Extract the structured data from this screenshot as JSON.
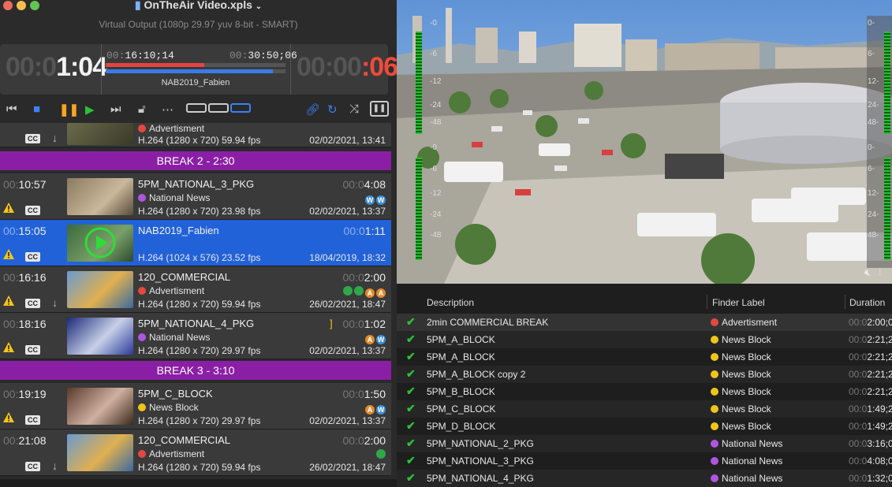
{
  "window": {
    "title": "OnTheAir Video.xpls",
    "subtitle": "Virtual Output (1080p 29.97 yuv 8-bit - SMART)"
  },
  "timer": {
    "elapsed_dim": "00:0",
    "elapsed": "1:04",
    "clip_start": "00:16:10;14",
    "clip_end": "00:30:50;06",
    "now_playing": "NAB2019_Fabien",
    "remaining_dim": "00:00",
    "remaining": ":06",
    "progress_red": 0.55,
    "progress_blue": 0.93
  },
  "playlist": {
    "top_row": {
      "label": "Advertisment",
      "codec": "H.264 (1280 x 720) 59.94 fps",
      "date": "02/02/2021, 13:41",
      "cc": "CC"
    },
    "break2": "BREAK 2 - 2:30",
    "break3": "BREAK 3 - 3:10",
    "rows": [
      {
        "start_dim": "00:",
        "start": "10:57",
        "name": "5PM_NATIONAL_3_PKG",
        "label": "National News",
        "codec": "H.264 (1280 x 720) 23.98 fps",
        "dur_dim": "00:0",
        "dur": "4:08",
        "date": "02/02/2021, 13:37",
        "cc": "CC"
      },
      {
        "start_dim": "00:",
        "start": "15:05",
        "name": "NAB2019_Fabien",
        "label": "",
        "codec": "H.264 (1024 x 576) 23.52 fps",
        "dur_dim": "00:0",
        "dur": "1:11",
        "date": "18/04/2019, 18:32",
        "cc": "CC"
      },
      {
        "start_dim": "00:",
        "start": "16:16",
        "name": "120_COMMERCIAL",
        "label": "Advertisment",
        "codec": "H.264 (1280 x 720) 59.94 fps",
        "dur_dim": "00:0",
        "dur": "2:00",
        "date": "26/02/2021, 18:47",
        "cc": "CC"
      },
      {
        "start_dim": "00:",
        "start": "18:16",
        "name": "5PM_NATIONAL_4_PKG",
        "label": "National News",
        "codec": "H.264 (1280 x 720) 29.97 fps",
        "dur_dim": "00:0",
        "dur": "1:02",
        "date": "02/02/2021, 13:37",
        "cc": "CC"
      },
      {
        "start_dim": "00:",
        "start": "19:19",
        "name": "5PM_C_BLOCK",
        "label": "News Block",
        "codec": "H.264 (1280 x 720) 29.97 fps",
        "dur_dim": "00:0",
        "dur": "1:50",
        "date": "02/02/2021, 13:37",
        "cc": "CC"
      },
      {
        "start_dim": "00:",
        "start": "21:08",
        "name": "120_COMMERCIAL",
        "label": "Advertisment",
        "codec": "H.264 (1280 x 720) 59.94 fps",
        "dur_dim": "00:0",
        "dur": "2:00",
        "date": "26/02/2021, 18:47",
        "cc": "CC"
      }
    ]
  },
  "meters": {
    "left": [
      "-0",
      "-6",
      "-12",
      "-24",
      "-48",
      "-0",
      "-6",
      "-12",
      "-24",
      "-48"
    ],
    "right": [
      "0-",
      "6-",
      "12-",
      "24-",
      "48-",
      "0-",
      "6-",
      "12-",
      "24-",
      "48-"
    ]
  },
  "table": {
    "headers": {
      "description": "Description",
      "finder_label": "Finder Label",
      "duration": "Duration"
    },
    "rows": [
      {
        "desc": "2min COMMERCIAL BREAK",
        "label": "Advertisment",
        "color": "#e5483f",
        "dur_dim": "00:0",
        "dur": "2:00;0"
      },
      {
        "desc": "5PM_A_BLOCK",
        "label": "News Block",
        "color": "#f0c419",
        "dur_dim": "00:0",
        "dur": "2:21;2"
      },
      {
        "desc": "5PM_A_BLOCK",
        "label": "News Block",
        "color": "#f0c419",
        "dur_dim": "00:0",
        "dur": "2:21;2"
      },
      {
        "desc": "5PM_A_BLOCK copy 2",
        "label": "News Block",
        "color": "#f0c419",
        "dur_dim": "00:0",
        "dur": "2:21;2"
      },
      {
        "desc": "5PM_B_BLOCK",
        "label": "News Block",
        "color": "#f0c419",
        "dur_dim": "00:0",
        "dur": "2:21;2"
      },
      {
        "desc": "5PM_C_BLOCK",
        "label": "News Block",
        "color": "#f0c419",
        "dur_dim": "00:0",
        "dur": "1:49;2"
      },
      {
        "desc": "5PM_D_BLOCK",
        "label": "News Block",
        "color": "#f0c419",
        "dur_dim": "00:0",
        "dur": "1:49;2"
      },
      {
        "desc": "5PM_NATIONAL_2_PKG",
        "label": "National News",
        "color": "#b055e0",
        "dur_dim": "00:0",
        "dur": "3:16;0"
      },
      {
        "desc": "5PM_NATIONAL_3_PKG",
        "label": "National News",
        "color": "#b055e0",
        "dur_dim": "00:0",
        "dur": "4:08;0"
      },
      {
        "desc": "5PM_NATIONAL_4_PKG",
        "label": "National News",
        "color": "#b055e0",
        "dur_dim": "00:0",
        "dur": "1:32;0"
      }
    ]
  },
  "colors": {
    "advert": "#e5483f",
    "national": "#b055e0",
    "newsblock": "#f0c419",
    "selection": "#2262d8",
    "break": "#8a1fa6"
  }
}
